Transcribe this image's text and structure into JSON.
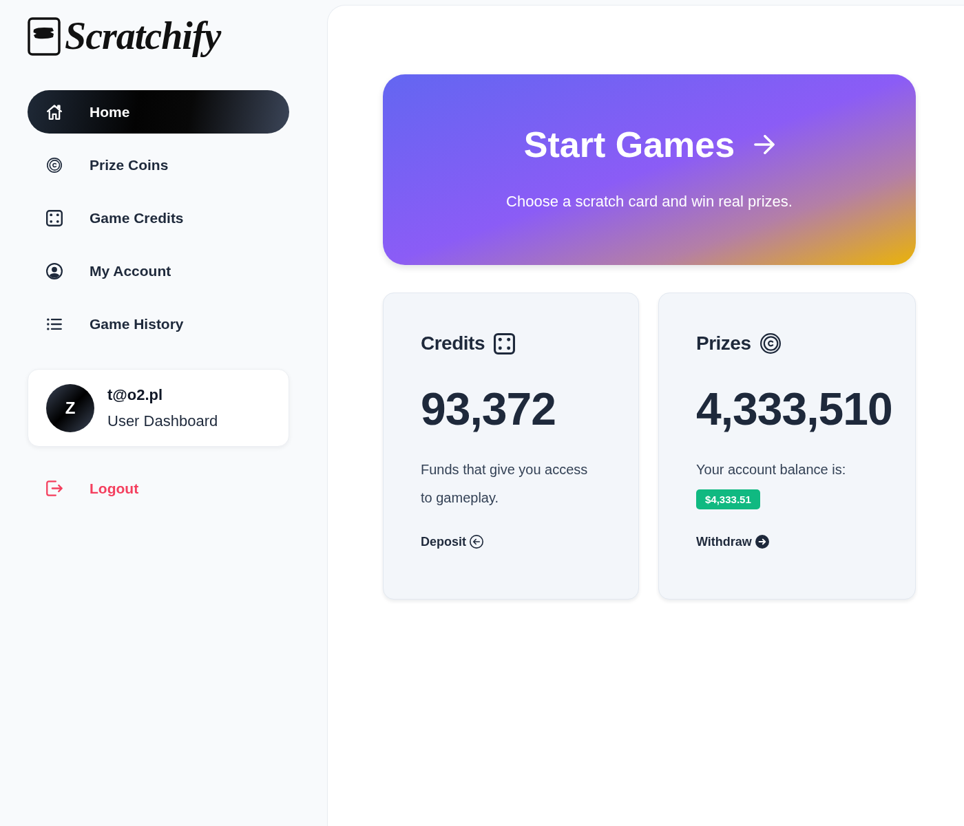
{
  "sidebar": {
    "logo": "Scratchify",
    "nav": [
      {
        "label": "Home",
        "selected": true
      },
      {
        "label": "Prize Coins",
        "selected": false
      },
      {
        "label": "Game Credits",
        "selected": false
      },
      {
        "label": "My Account",
        "selected": false
      },
      {
        "label": "Game History",
        "selected": false
      }
    ],
    "user": {
      "avatar_initial": "Z",
      "email": "t@o2.pl",
      "role": "User Dashboard"
    },
    "logout": {
      "label": "Logout"
    }
  },
  "hero": {
    "title": "Start Games",
    "subtitle": "Choose a scratch card and win real prizes."
  },
  "cards": [
    {
      "title": "Credits",
      "value": "93,372",
      "description": "Funds that give you access to gameplay.",
      "action": {
        "label": "Deposit"
      }
    },
    {
      "title": "Prizes",
      "value": "4,333,510",
      "description": "Your account balance is:",
      "badge": "$4,333.51",
      "action": {
        "label": "Withdraw"
      }
    }
  ]
}
